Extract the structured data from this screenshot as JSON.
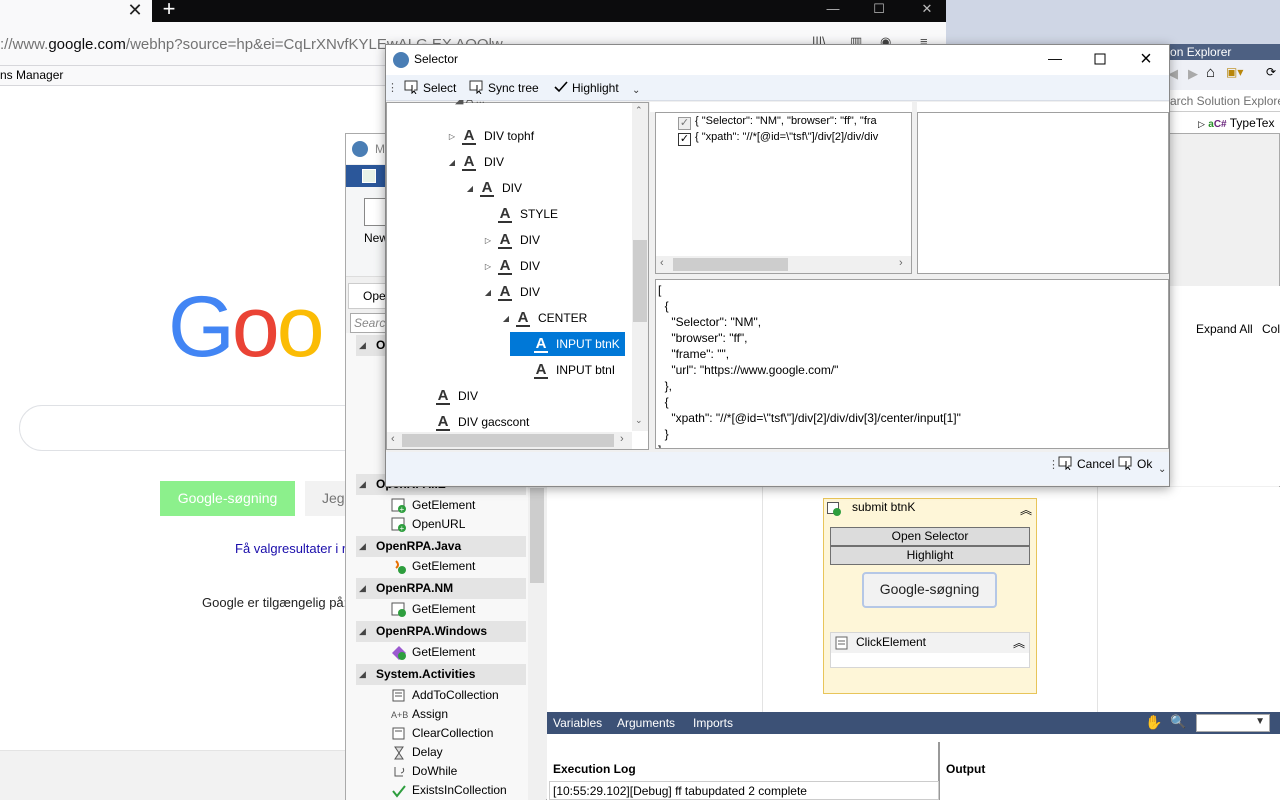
{
  "browser": {
    "url_prefix": "://www.",
    "url_domain": "google.com",
    "url_rest": "/webhp?source=hp&ei=CqLrXNvfKYLEwALG EX AOOlw",
    "bookmark": "ns Manager",
    "tab_close_glyph": "✕",
    "new_tab_glyph": "+"
  },
  "google": {
    "logo_g": "G",
    "logo_o1": "o",
    "logo_o2": "o",
    "search_button": "Google-søgning",
    "lucky_button": "Jeg",
    "settings_link": "Få valgresultater i r",
    "available_in": "Google er tilgængelig på:"
  },
  "visual_studio": {
    "solution_explorer_title": "olution Explorer",
    "search_placeholder": "arch Solution Explore",
    "tree_item": "TypeTex",
    "expand_all": "Expand All",
    "collapse_all": "Coll"
  },
  "openrpa": {
    "title_fragment": "M",
    "new_label": "New",
    "open_tab": "Ope",
    "search_placeholder": "Search",
    "toolbox": [
      {
        "category": "O",
        "top": 0,
        "items": []
      },
      {
        "category": "OpenRPA.IE",
        "items": [
          "GetElement",
          "OpenURL"
        ]
      },
      {
        "category": "OpenRPA.Java",
        "items": [
          "GetElement"
        ]
      },
      {
        "category": "OpenRPA.NM",
        "items": [
          "GetElement"
        ]
      },
      {
        "category": "OpenRPA.Windows",
        "items": [
          "GetElement"
        ]
      },
      {
        "category": "System.Activities",
        "items": [
          "AddToCollection",
          "Assign",
          "ClearCollection",
          "Delay",
          "DoWhile",
          "ExistsInCollection"
        ]
      }
    ],
    "activity": {
      "title": "submit btnK",
      "open_selector": "Open Selector",
      "highlight": "Highlight",
      "preview_button": "Google-søgning",
      "child_title": "ClickElement"
    },
    "bottom_tabs": {
      "variables": "Variables",
      "arguments": "Arguments",
      "imports": "Imports"
    },
    "execution_log_label": "Execution Log",
    "output_label": "Output",
    "log_line": "[10:55:29.102][Debug] ff tabupdated 2 complete"
  },
  "selector_dialog": {
    "title": "Selector",
    "toolbar": {
      "select": "Select",
      "sync_tree": "Sync tree",
      "highlight": "Highlight"
    },
    "tree_partial_top": "...",
    "tree": [
      {
        "label": "DIV tophf",
        "expander": "▷",
        "depth": 0
      },
      {
        "label": "DIV",
        "expander": "◢",
        "depth": 0
      },
      {
        "label": "DIV",
        "expander": "◢",
        "depth": 1
      },
      {
        "label": "STYLE",
        "expander": "",
        "depth": 2
      },
      {
        "label": "DIV",
        "expander": "▷",
        "depth": 2
      },
      {
        "label": "DIV",
        "expander": "▷",
        "depth": 2
      },
      {
        "label": "DIV",
        "expander": "◢",
        "depth": 2
      },
      {
        "label": "CENTER",
        "expander": "◢",
        "depth": 3
      },
      {
        "label": "INPUT btnK",
        "expander": "",
        "depth": 4,
        "selected": true
      },
      {
        "label": "INPUT btnI",
        "expander": "",
        "depth": 4
      },
      {
        "label": "DIV",
        "expander": "",
        "depth": -1
      },
      {
        "label": "DIV gacscont",
        "expander": "",
        "depth": -1
      }
    ],
    "selector_items": [
      {
        "text": "{   \"Selector\": \"NM\",   \"browser\": \"ff\",   \"fra",
        "checked": true,
        "disabled": true
      },
      {
        "text": "{   \"xpath\": \"//*[@id=\\\"tsf\\\"]/div[2]/div/div",
        "checked": true,
        "disabled": false
      }
    ],
    "json_text": "[\n  {\n    \"Selector\": \"NM\",\n    \"browser\": \"ff\",\n    \"frame\": \"\",\n    \"url\": \"https://www.google.com/\"\n  },\n  {\n    \"xpath\": \"//*[@id=\\\"tsf\\\"]/div[2]/div/div[3]/center/input[1]\"\n  }\n]",
    "cancel": "Cancel",
    "ok": "Ok"
  },
  "colors": {
    "selection": "#0078d7",
    "google_button": "#8cf08c",
    "activity_bg": "#fef6d8",
    "vs_blue": "#3c5176"
  }
}
